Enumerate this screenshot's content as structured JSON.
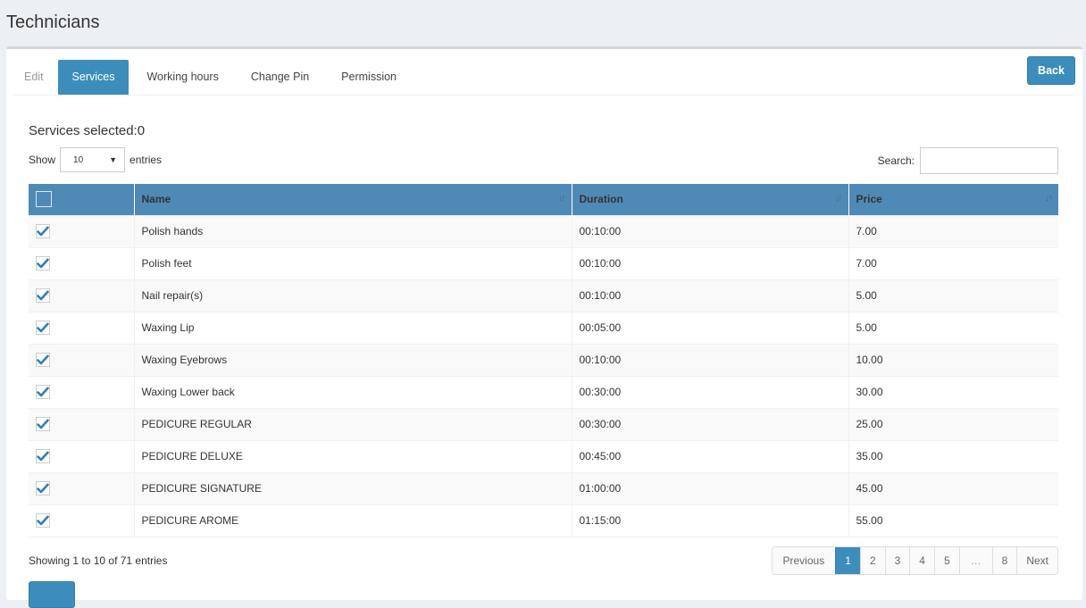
{
  "page": {
    "title": "Technicians"
  },
  "tabs": [
    {
      "label": "Edit",
      "active": false
    },
    {
      "label": "Services",
      "active": true
    },
    {
      "label": "Working hours",
      "active": false
    },
    {
      "label": "Change Pin",
      "active": false
    },
    {
      "label": "Permission",
      "active": false
    }
  ],
  "toolbar": {
    "back_label": "Back"
  },
  "services_selected": "Services selected:0",
  "length_menu": {
    "show_label": "Show",
    "selected": "10",
    "entries_label": "entries"
  },
  "search": {
    "label": "Search:",
    "value": "",
    "placeholder": ""
  },
  "table": {
    "columns": [
      "",
      "Name",
      "Duration",
      "Price"
    ],
    "rows": [
      {
        "checked": true,
        "name": "Polish hands",
        "duration": "00:10:00",
        "price": "7.00"
      },
      {
        "checked": true,
        "name": "Polish feet",
        "duration": "00:10:00",
        "price": "7.00"
      },
      {
        "checked": true,
        "name": "Nail repair(s)",
        "duration": "00:10:00",
        "price": "5.00"
      },
      {
        "checked": true,
        "name": "Waxing Lip",
        "duration": "00:05:00",
        "price": "5.00"
      },
      {
        "checked": true,
        "name": "Waxing Eyebrows",
        "duration": "00:10:00",
        "price": "10.00"
      },
      {
        "checked": true,
        "name": "Waxing Lower back",
        "duration": "00:30:00",
        "price": "30.00"
      },
      {
        "checked": true,
        "name": "PEDICURE REGULAR",
        "duration": "00:30:00",
        "price": "25.00"
      },
      {
        "checked": true,
        "name": "PEDICURE DELUXE",
        "duration": "00:45:00",
        "price": "35.00"
      },
      {
        "checked": true,
        "name": "PEDICURE SIGNATURE",
        "duration": "01:00:00",
        "price": "45.00"
      },
      {
        "checked": true,
        "name": "PEDICURE AROME",
        "duration": "01:15:00",
        "price": "55.00"
      }
    ]
  },
  "info": "Showing 1 to 10 of 71 entries",
  "pagination": {
    "previous": "Previous",
    "pages": [
      "1",
      "2",
      "3",
      "4",
      "5",
      "…",
      "8"
    ],
    "active": "1",
    "next": "Next"
  },
  "colors": {
    "primary": "#3c8dbc",
    "header": "#4f8ab7",
    "background": "#ecf0f5"
  }
}
